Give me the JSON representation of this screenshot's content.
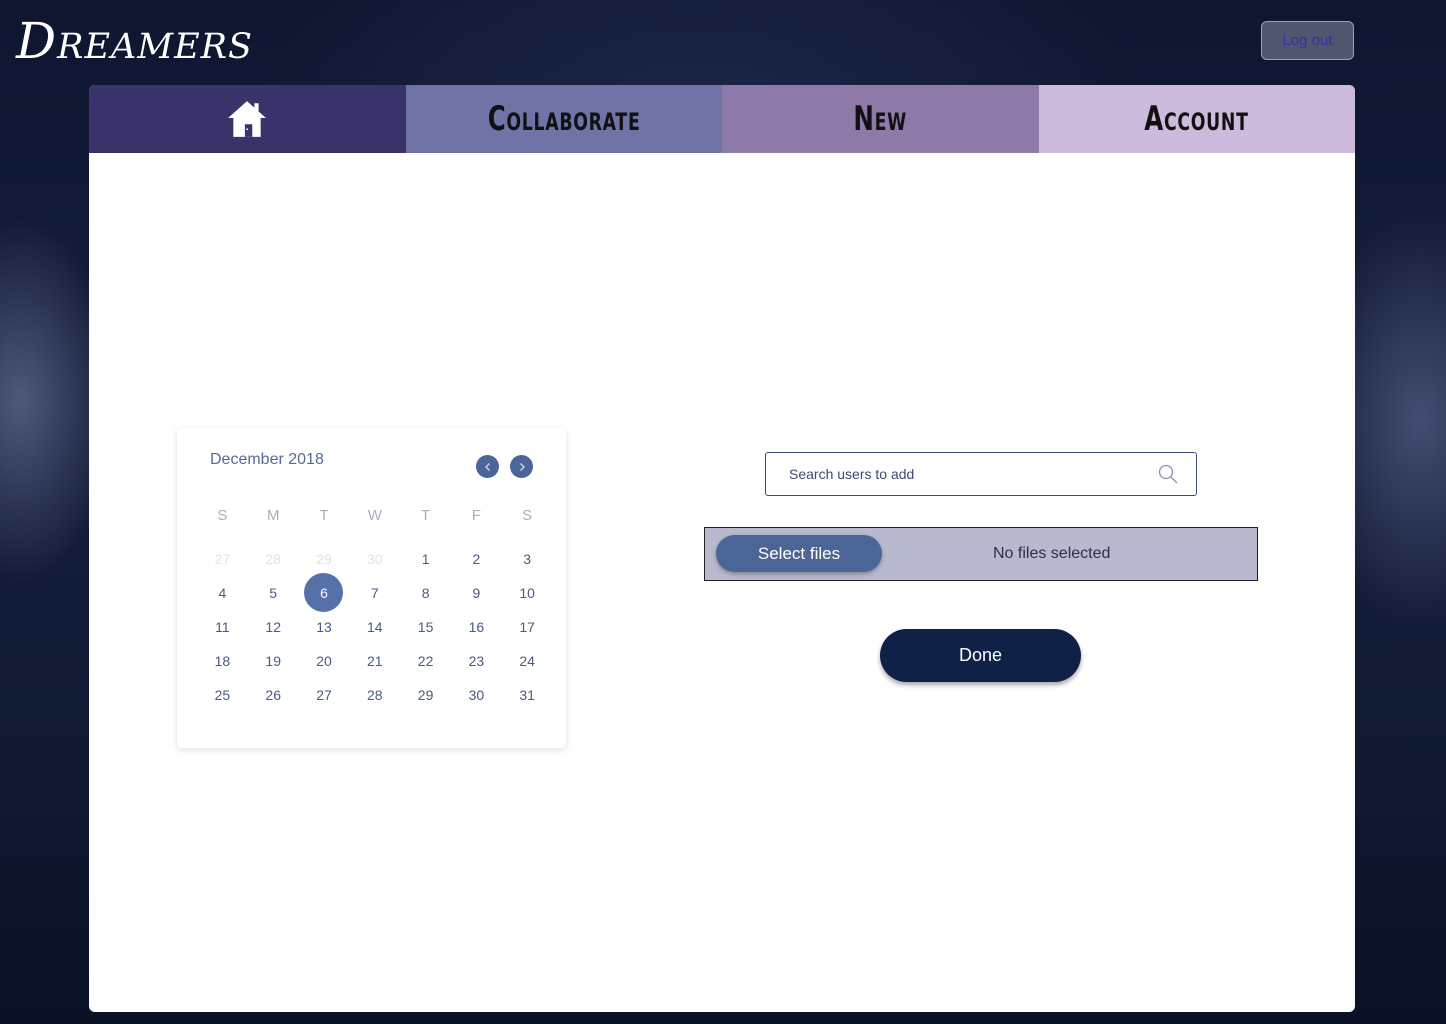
{
  "app": {
    "logo": "Dreamers"
  },
  "header": {
    "logout_label": "Log out"
  },
  "tabs": [
    {
      "id": "home",
      "icon": "home-icon"
    },
    {
      "id": "collaborate",
      "label": "Collaborate"
    },
    {
      "id": "new",
      "label": "New"
    },
    {
      "id": "account",
      "label": "Account"
    }
  ],
  "calendar": {
    "title": "December 2018",
    "prev_icon": "chevron-left-icon",
    "next_icon": "chevron-right-icon",
    "weekdays": [
      "S",
      "M",
      "T",
      "W",
      "T",
      "F",
      "S"
    ],
    "weeks": [
      [
        "27",
        "28",
        "29",
        "30",
        "1",
        "2",
        "3"
      ],
      [
        "4",
        "5",
        "6",
        "7",
        "8",
        "9",
        "10"
      ],
      [
        "11",
        "12",
        "13",
        "14",
        "15",
        "16",
        "17"
      ],
      [
        "18",
        "19",
        "20",
        "21",
        "22",
        "23",
        "24"
      ],
      [
        "25",
        "26",
        "27",
        "28",
        "29",
        "30",
        "31"
      ]
    ],
    "selected_day": "6"
  },
  "search": {
    "placeholder": "Search users to add",
    "value": "",
    "icon": "search-icon"
  },
  "file_picker": {
    "button_label": "Select files",
    "status": "No files selected"
  },
  "done_label": "Done",
  "colors": {
    "accent": "#4c6598",
    "tab_home": "#38336a",
    "tab_collaborate": "#6f73a6",
    "tab_new": "#8d7aa9",
    "tab_account": "#cdbbdd",
    "done": "#0f2147"
  }
}
